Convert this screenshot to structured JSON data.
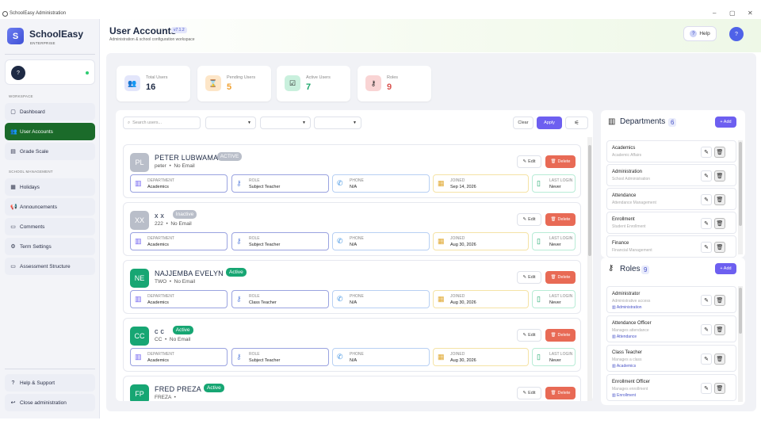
{
  "window": {
    "title": "SchoolEasy Administration",
    "min": "–",
    "max": "▢",
    "close": "✕"
  },
  "brand": {
    "logo_letter": "S",
    "name": "SchoolEasy",
    "edition": "ENTERPRISE"
  },
  "user": {
    "avatar": "?"
  },
  "sidebar": {
    "section_workspace": "WORKSPACE",
    "section_management": "SCHOOL MANAGEMENT",
    "items": [
      {
        "label": "Dashboard",
        "icon": "▢"
      },
      {
        "label": "User Accounts",
        "icon": "👥"
      },
      {
        "label": "Grade Scale",
        "icon": "▤"
      },
      {
        "label": "Holidays",
        "icon": "▦"
      },
      {
        "label": "Announcements",
        "icon": "📢"
      },
      {
        "label": "Comments",
        "icon": "▭"
      },
      {
        "label": "Term Settings",
        "icon": "⚙"
      },
      {
        "label": "Assessment Structure",
        "icon": "▭"
      }
    ],
    "footer": [
      {
        "label": "Help & Support",
        "icon": "?"
      },
      {
        "label": "Close administration",
        "icon": "↩"
      }
    ]
  },
  "header": {
    "title": "User Accounts",
    "version": "v7.1.2",
    "subtitle": "Administration & school configuration workspace",
    "help_label": "Help",
    "avatar": "?"
  },
  "stats": [
    {
      "label": "Total Users",
      "value": "16",
      "icon": "👥",
      "bg": "#e3e6fb",
      "color": "#1e2a44"
    },
    {
      "label": "Pending Users",
      "value": "5",
      "icon": "⌛",
      "bg": "#fde6c8",
      "color": "#f0a030"
    },
    {
      "label": "Active Users",
      "value": "7",
      "icon": "☑",
      "bg": "#c9f0dd",
      "color": "#1aa66a"
    },
    {
      "label": "Roles",
      "value": "9",
      "icon": "⚷",
      "bg": "#f9d4d4",
      "color": "#d9534f"
    }
  ],
  "toolbar": {
    "search_placeholder": "Search users...",
    "clear_label": "Clear",
    "apply_label": "Apply",
    "filter_icon": "⚟"
  },
  "field_labels": {
    "department": "DEPARTMENT",
    "role": "ROLE",
    "phone": "PHONE",
    "joined": "JOINED",
    "last_login": "LAST LOGIN"
  },
  "actions": {
    "edit": "Edit",
    "delete": "Delete"
  },
  "users": [
    {
      "initials": "PL",
      "name": "PETER LUBWAMA",
      "status": "ACTIVE",
      "username": "peter",
      "email": "No Email",
      "department": "Academics",
      "role": "Subject Teacher",
      "phone": "N/A",
      "joined": "Sep 14, 2026",
      "last_login": "Never",
      "avatar_color": "#b9bec9",
      "badge_color": "#b9bec9"
    },
    {
      "initials": "XX",
      "name": "x x",
      "status": "Inactive",
      "username": "222",
      "email": "No Email",
      "department": "Academics",
      "role": "Subject Teacher",
      "phone": "N/A",
      "joined": "Aug 30, 2026",
      "last_login": "Never",
      "avatar_color": "#b9bec9",
      "badge_color": "#b9bec9"
    },
    {
      "initials": "NE",
      "name": "NAJJEMBA EVELYN",
      "status": "Active",
      "username": "TWO",
      "email": "No Email",
      "department": "Academics",
      "role": "Class Teacher",
      "phone": "N/A",
      "joined": "Aug 30, 2026",
      "last_login": "Never",
      "avatar_color": "#17a673",
      "badge_color": "#17a673"
    },
    {
      "initials": "CC",
      "name": "c c",
      "status": "Active",
      "username": "CC",
      "email": "No Email",
      "department": "Academics",
      "role": "Subject Teacher",
      "phone": "N/A",
      "joined": "Aug 30, 2026",
      "last_login": "Never",
      "avatar_color": "#17a673",
      "badge_color": "#17a673"
    },
    {
      "initials": "FP",
      "name": "FRED PREZA",
      "status": "Active",
      "username": "FREZA",
      "email": "",
      "department": "",
      "role": "",
      "phone": "",
      "joined": "",
      "last_login": "",
      "avatar_color": "#17a673",
      "badge_color": "#17a673"
    }
  ],
  "departments": {
    "title": "Departments",
    "count": "6",
    "add_label": "+ Add",
    "items": [
      {
        "name": "Academics",
        "desc": "Academic Affairs"
      },
      {
        "name": "Administration",
        "desc": "School Administration"
      },
      {
        "name": "Attendance",
        "desc": "Attendance Management"
      },
      {
        "name": "Enrollment",
        "desc": "Student Enrollment"
      },
      {
        "name": "Finance",
        "desc": "Financial Management"
      }
    ]
  },
  "roles": {
    "title": "Roles",
    "count": "9",
    "add_label": "+ Add",
    "items": [
      {
        "name": "Administrator",
        "desc": "Administrative access",
        "dept": "Administration"
      },
      {
        "name": "Attendance Officer",
        "desc": "Manages attendance",
        "dept": "Attendance"
      },
      {
        "name": "Class Teacher",
        "desc": "Manages a class",
        "dept": "Academics"
      },
      {
        "name": "Enrollment Officer",
        "desc": "Manages enrollment",
        "dept": "Enrollment"
      }
    ]
  }
}
